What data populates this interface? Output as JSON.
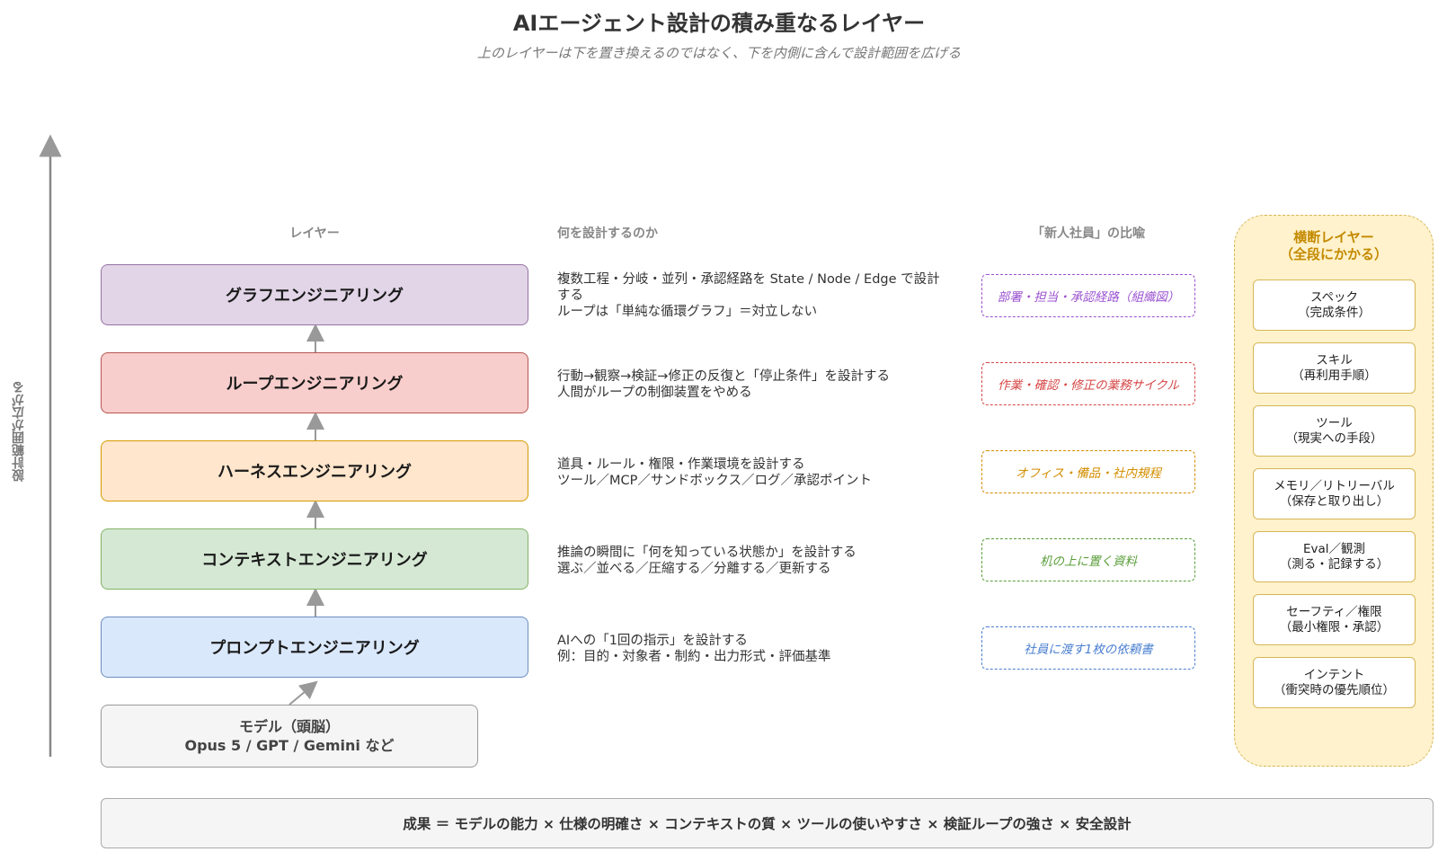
{
  "header": {
    "title": "AIエージェント設計の積み重なるレイヤー",
    "subtitle": "上のレイヤーは下を置き換えるのではなく、下を内側に含んで設計範囲を広げる"
  },
  "axis": {
    "label": "設計範囲が広がる"
  },
  "columns": {
    "layer": "レイヤー",
    "what": "何を設計するのか",
    "metaphor": "「新人社員」の比喩"
  },
  "layers": [
    {
      "name": "グラフエンジニアリング",
      "desc1": "複数工程・分岐・並列・承認経路を State / Node / Edge で設計",
      "desc2": "する",
      "desc3": "ループは「単純な循環グラフ」＝対立しない",
      "metaphor": "部署・担当・承認経路（組織図）",
      "fill": "#e1d5e7",
      "stroke": "#9673a6",
      "meta_color": "#9b51d0"
    },
    {
      "name": "ループエンジニアリング",
      "desc1": "行動→観察→検証→修正の反復と「停止条件」を設計する",
      "desc2": "人間がループの制御装置をやめる",
      "metaphor": "作業・確認・修正の業務サイクル",
      "fill": "#f8cecc",
      "stroke": "#b85450",
      "meta_color": "#d64545"
    },
    {
      "name": "ハーネスエンジニアリング",
      "desc1": "道具・ルール・権限・作業環境を設計する",
      "desc2": "ツール／MCP／サンドボックス／ログ／承認ポイント",
      "metaphor": "オフィス・備品・社内規程",
      "fill": "#ffe6cc",
      "stroke": "#d79b00",
      "meta_color": "#d38e00"
    },
    {
      "name": "コンテキストエンジニアリング",
      "desc1": "推論の瞬間に「何を知っている状態か」を設計する",
      "desc2": "選ぶ／並べる／圧縮する／分離する／更新する",
      "metaphor": "机の上に置く資料",
      "fill": "#d5e8d4",
      "stroke": "#82b366",
      "meta_color": "#5a9e3a"
    },
    {
      "name": "プロンプトエンジニアリング",
      "desc1": "AIへの「1回の指示」を設計する",
      "desc2": "例：目的・対象者・制約・出力形式・評価基準",
      "metaphor": "社員に渡す1枚の依頼書",
      "fill": "#dae8fc",
      "stroke": "#6c8ebf",
      "meta_color": "#4a7fd0"
    }
  ],
  "model": {
    "line1": "モデル（頭脳）",
    "line2": "Opus 5 / GPT / Gemini など"
  },
  "cross_layer": {
    "title1": "横断レイヤー",
    "title2": "（全段にかかる）",
    "items": [
      {
        "name": "スペック",
        "sub": "（完成条件）"
      },
      {
        "name": "スキル",
        "sub": "（再利用手順）"
      },
      {
        "name": "ツール",
        "sub": "（現実への手段）"
      },
      {
        "name": "メモリ／リトリーバル",
        "sub": "（保存と取り出し）"
      },
      {
        "name": "Eval／観測",
        "sub": "（測る・記録する）"
      },
      {
        "name": "セーフティ／権限",
        "sub": "（最小権限・承認）"
      },
      {
        "name": "インテント",
        "sub": "（衝突時の優先順位）"
      }
    ]
  },
  "result": {
    "text": "成果 ＝ モデルの能力 × 仕様の明確さ × コンテキストの質 × ツールの使いやすさ × 検証ループの強さ × 安全設計"
  }
}
